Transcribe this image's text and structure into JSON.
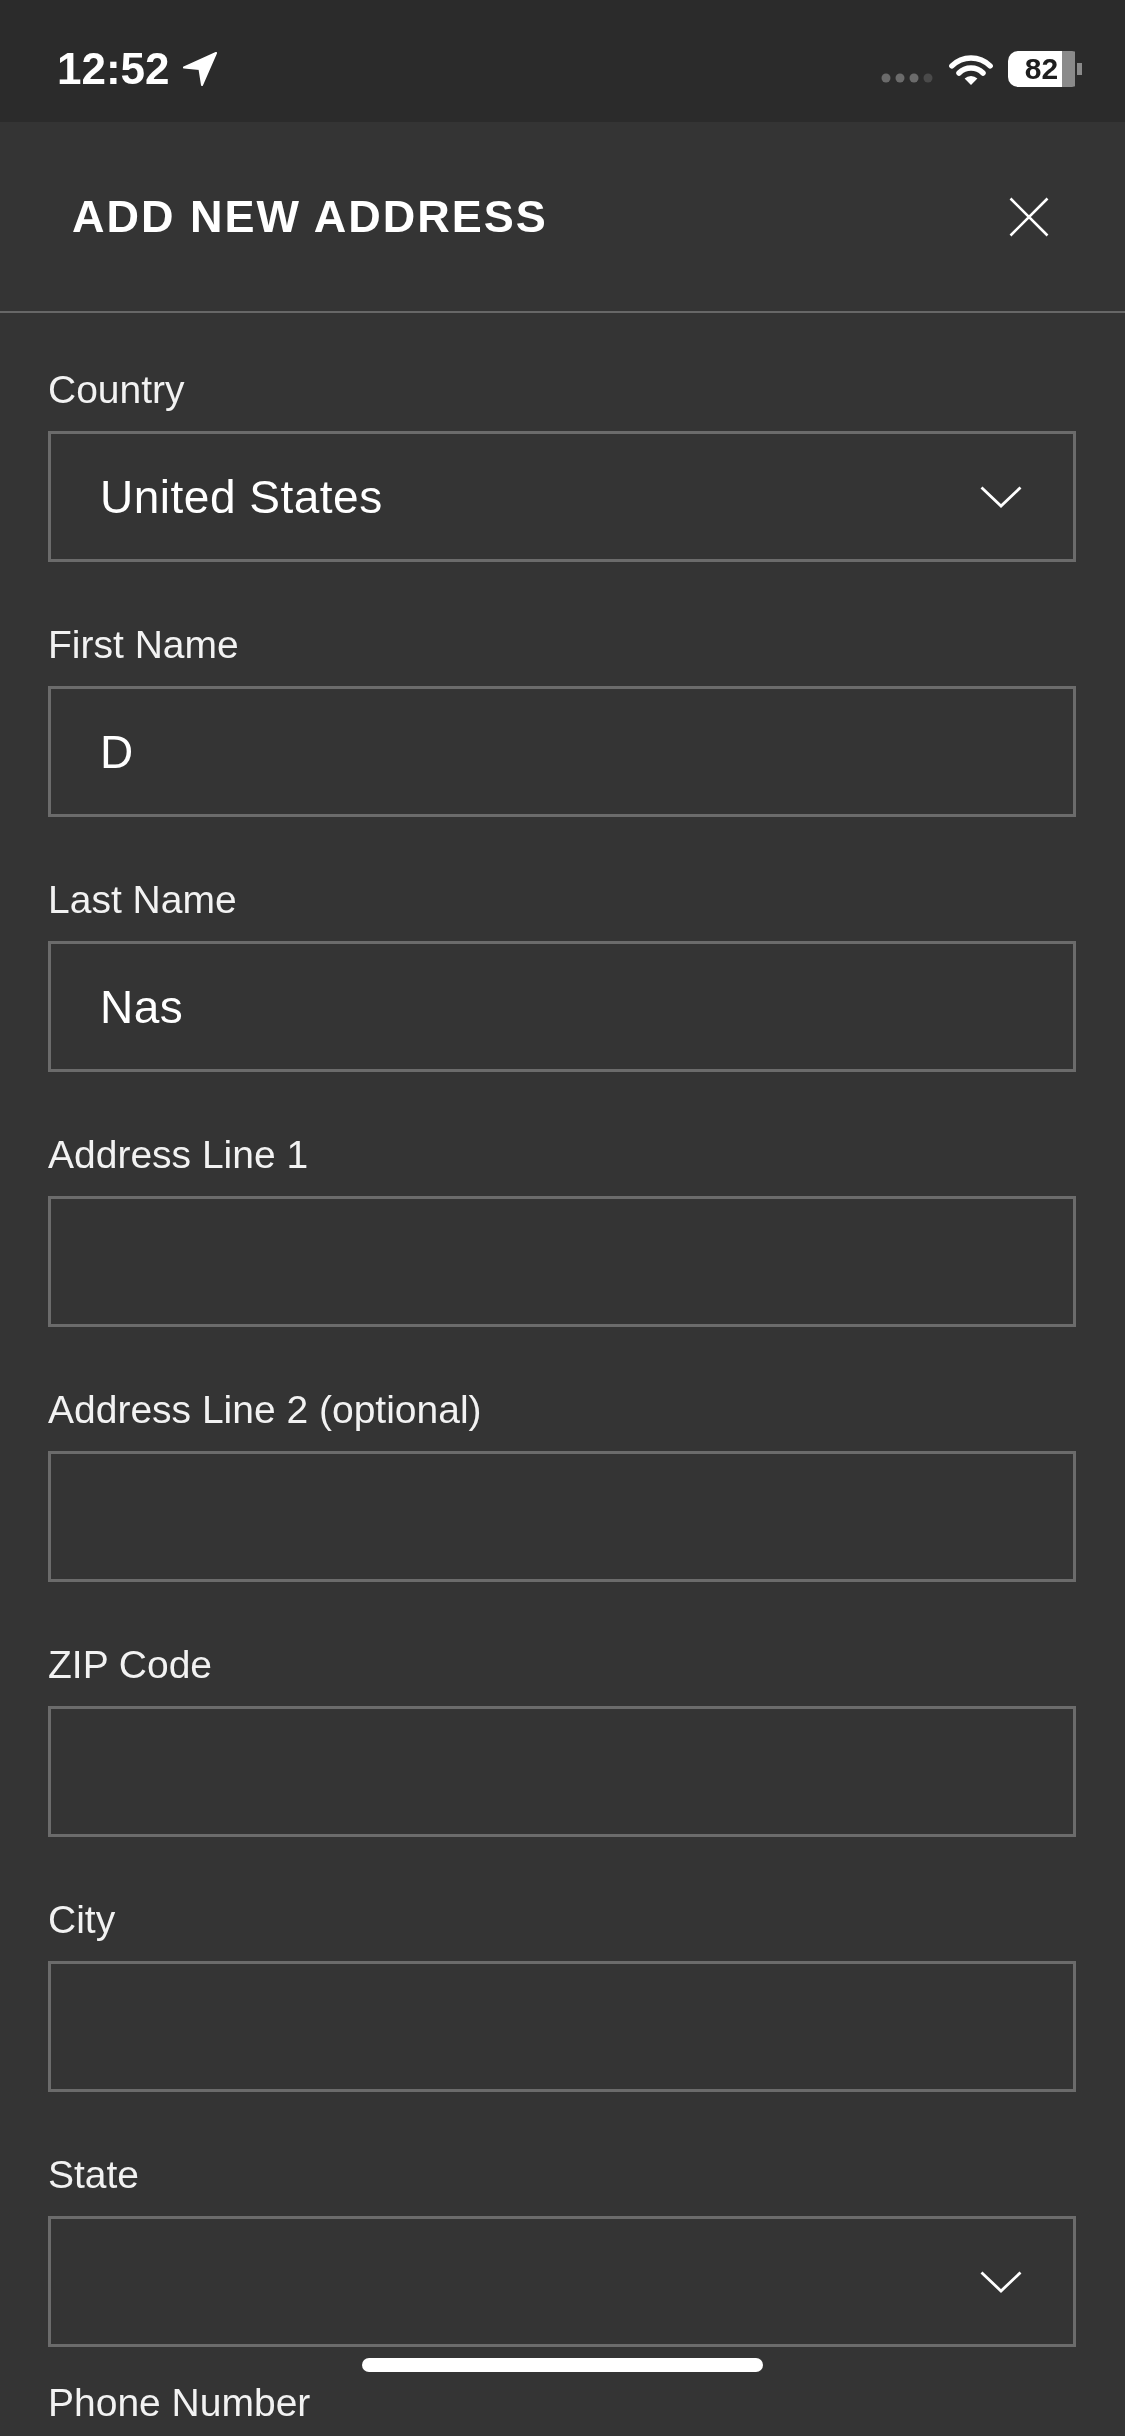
{
  "status_bar": {
    "time": "12:52",
    "battery": "82"
  },
  "sheet": {
    "title": "ADD NEW ADDRESS"
  },
  "fields": [
    {
      "kind": "select",
      "label": "Country",
      "value": "United States"
    },
    {
      "kind": "text",
      "label": "First Name",
      "value": "D"
    },
    {
      "kind": "text",
      "label": "Last Name",
      "value": "Nas"
    },
    {
      "kind": "text",
      "label": "Address Line 1"
    },
    {
      "kind": "text",
      "label": "Address Line 2 (optional)"
    },
    {
      "kind": "text",
      "label": "ZIP Code"
    },
    {
      "kind": "text",
      "label": "City"
    },
    {
      "kind": "select",
      "label": "State"
    },
    {
      "kind": "label",
      "label": "Phone Number"
    }
  ]
}
